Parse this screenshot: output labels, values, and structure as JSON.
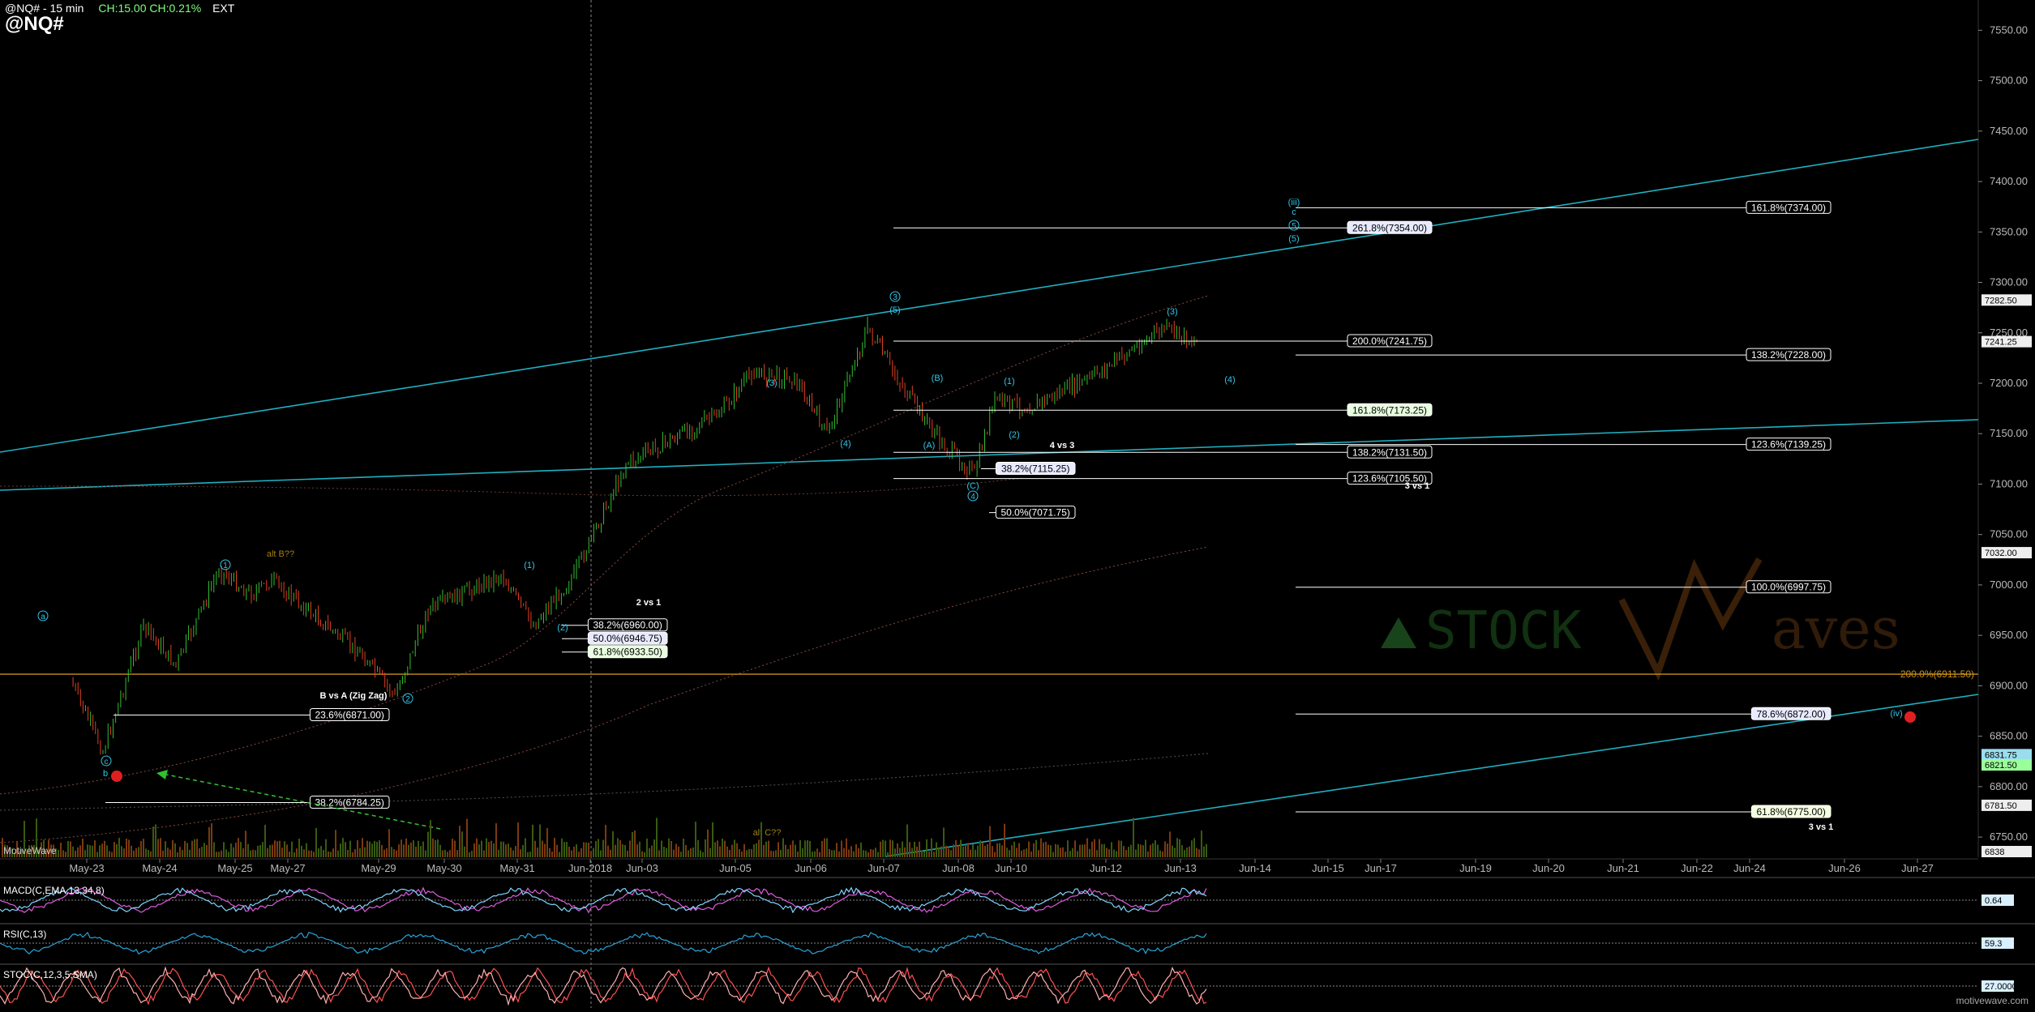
{
  "header": {
    "title": "@NQ# - 15 min",
    "change": "CH:15.00  CH:0.21%",
    "session": "EXT",
    "symbol": "@NQ#"
  },
  "watermark": {
    "brand_prefix": "STOCK",
    "brand_suffix": "aves"
  },
  "credit": "MotiveWave",
  "site": "motivewave.com",
  "colors": {
    "background": "#000000",
    "trendline": "#1fb0c0",
    "fib_line": "#ffffff",
    "orange_level": "#c8901a",
    "wave_label": "#2fc6e8",
    "alt_label": "#a08010",
    "macd_line": "#e05ce0",
    "macd_signal": "#7fd6ff",
    "rsi": "#2aa4d8",
    "stoch_k": "#ff5050",
    "stoch_d": "#ffb0b0"
  },
  "chart_data": [
    {
      "type": "line",
      "title": "@NQ# - 15 min",
      "xlabel": "",
      "ylabel": "",
      "ylim": [
        6730,
        7580
      ],
      "grid": false,
      "x_ticks": [
        "May-23",
        "May-24",
        "May-25",
        "May-27",
        "May-29",
        "May-30",
        "May-31",
        "Jun-2018",
        "Jun-03",
        "Jun-05",
        "Jun-06",
        "Jun-07",
        "Jun-08",
        "Jun-10",
        "Jun-12",
        "Jun-13",
        "Jun-14",
        "Jun-15",
        "Jun-17",
        "Jun-19",
        "Jun-20",
        "Jun-21",
        "Jun-22",
        "Jun-24",
        "Jun-26",
        "Jun-27"
      ],
      "y_ticks": [
        6750,
        6800,
        6850,
        6900,
        6950,
        7000,
        7050,
        7100,
        7150,
        7200,
        7250,
        7300,
        7350,
        7400,
        7450,
        7500,
        7550
      ],
      "price_tags": [
        "7282.50",
        "7241.25",
        "7032.00",
        "6831.75",
        "6821.50",
        "6781.50",
        "6838"
      ],
      "series": [
        {
          "x": [
            "May-23",
            "May-23",
            "May-24",
            "May-24",
            "May-25",
            "May-25",
            "May-27",
            "May-29",
            "May-29",
            "May-30",
            "May-31",
            "May-31",
            "Jun-2018",
            "Jun-03",
            "Jun-05",
            "Jun-05",
            "Jun-06",
            "Jun-06",
            "Jun-07",
            "Jun-07",
            "Jun-08",
            "Jun-08",
            "Jun-10",
            "Jun-10",
            "Jun-12",
            "Jun-13",
            "Jun-13"
          ],
          "values": [
            6905,
            6835,
            6960,
            6920,
            7015,
            6990,
            7005,
            6930,
            6890,
            6975,
            7010,
            6960,
            7010,
            7120,
            7170,
            7210,
            7205,
            7150,
            7255,
            7200,
            7140,
            7110,
            7185,
            7175,
            7205,
            7255,
            7240
          ]
        }
      ],
      "fib_levels": [
        {
          "label": "161.8%(7374.00)",
          "value": 7374.0
        },
        {
          "label": "261.8%(7354.00)",
          "value": 7354.0
        },
        {
          "label": "200.0%(7241.75)",
          "value": 7241.75
        },
        {
          "label": "138.2%(7228.00)",
          "value": 7228.0
        },
        {
          "label": "161.8%(7173.25)",
          "value": 7173.25
        },
        {
          "label": "123.6%(7139.25)",
          "value": 7139.25
        },
        {
          "label": "138.2%(7131.50)",
          "value": 7131.5
        },
        {
          "label": "38.2%(7115.25)",
          "value": 7115.25
        },
        {
          "label": "123.6%(7105.50)",
          "value": 7105.5
        },
        {
          "label": "50.0%(7071.75)",
          "value": 7071.75
        },
        {
          "label": "100.0%(6997.75)",
          "value": 6997.75
        },
        {
          "label": "38.2%(6960.00)",
          "value": 6960.0
        },
        {
          "label": "50.0%(6946.75)",
          "value": 6946.75
        },
        {
          "label": "61.8%(6933.50)",
          "value": 6933.5
        },
        {
          "label": "200.0%(6911.50)",
          "value": 6911.5
        },
        {
          "label": "78.6%(6872.00)",
          "value": 6872.0
        },
        {
          "label": "23.6%(6871.00)",
          "value": 6871.0
        },
        {
          "label": "38.2%(6784.25)",
          "value": 6784.25
        },
        {
          "label": "61.8%(6775.00)",
          "value": 6775.0
        }
      ],
      "annotations": [
        "(iii)",
        "c",
        "5",
        "(5)",
        "3",
        "(5)",
        "(3)",
        "(4)",
        "(3)",
        "(4)",
        "(B)",
        "(A)",
        "(C)",
        "4",
        "(1)",
        "(2)",
        "4 vs 3",
        "3 vs 1",
        "2 vs 1",
        "(1)",
        "(2)",
        "1",
        "2",
        "alt B??",
        "alt C??",
        "a",
        "c",
        "b",
        "B vs A (Zig Zag)",
        "3 vs 1",
        "(iv)"
      ]
    },
    {
      "type": "line",
      "title": "MACD(C,EMA,13,34,8)",
      "value_tag": "0.64"
    },
    {
      "type": "line",
      "title": "RSI(C,13)",
      "value_tag": "59.3"
    },
    {
      "type": "line",
      "title": "STOC(C,12,3,5,SMA)",
      "value_tag": "27.0000"
    }
  ]
}
